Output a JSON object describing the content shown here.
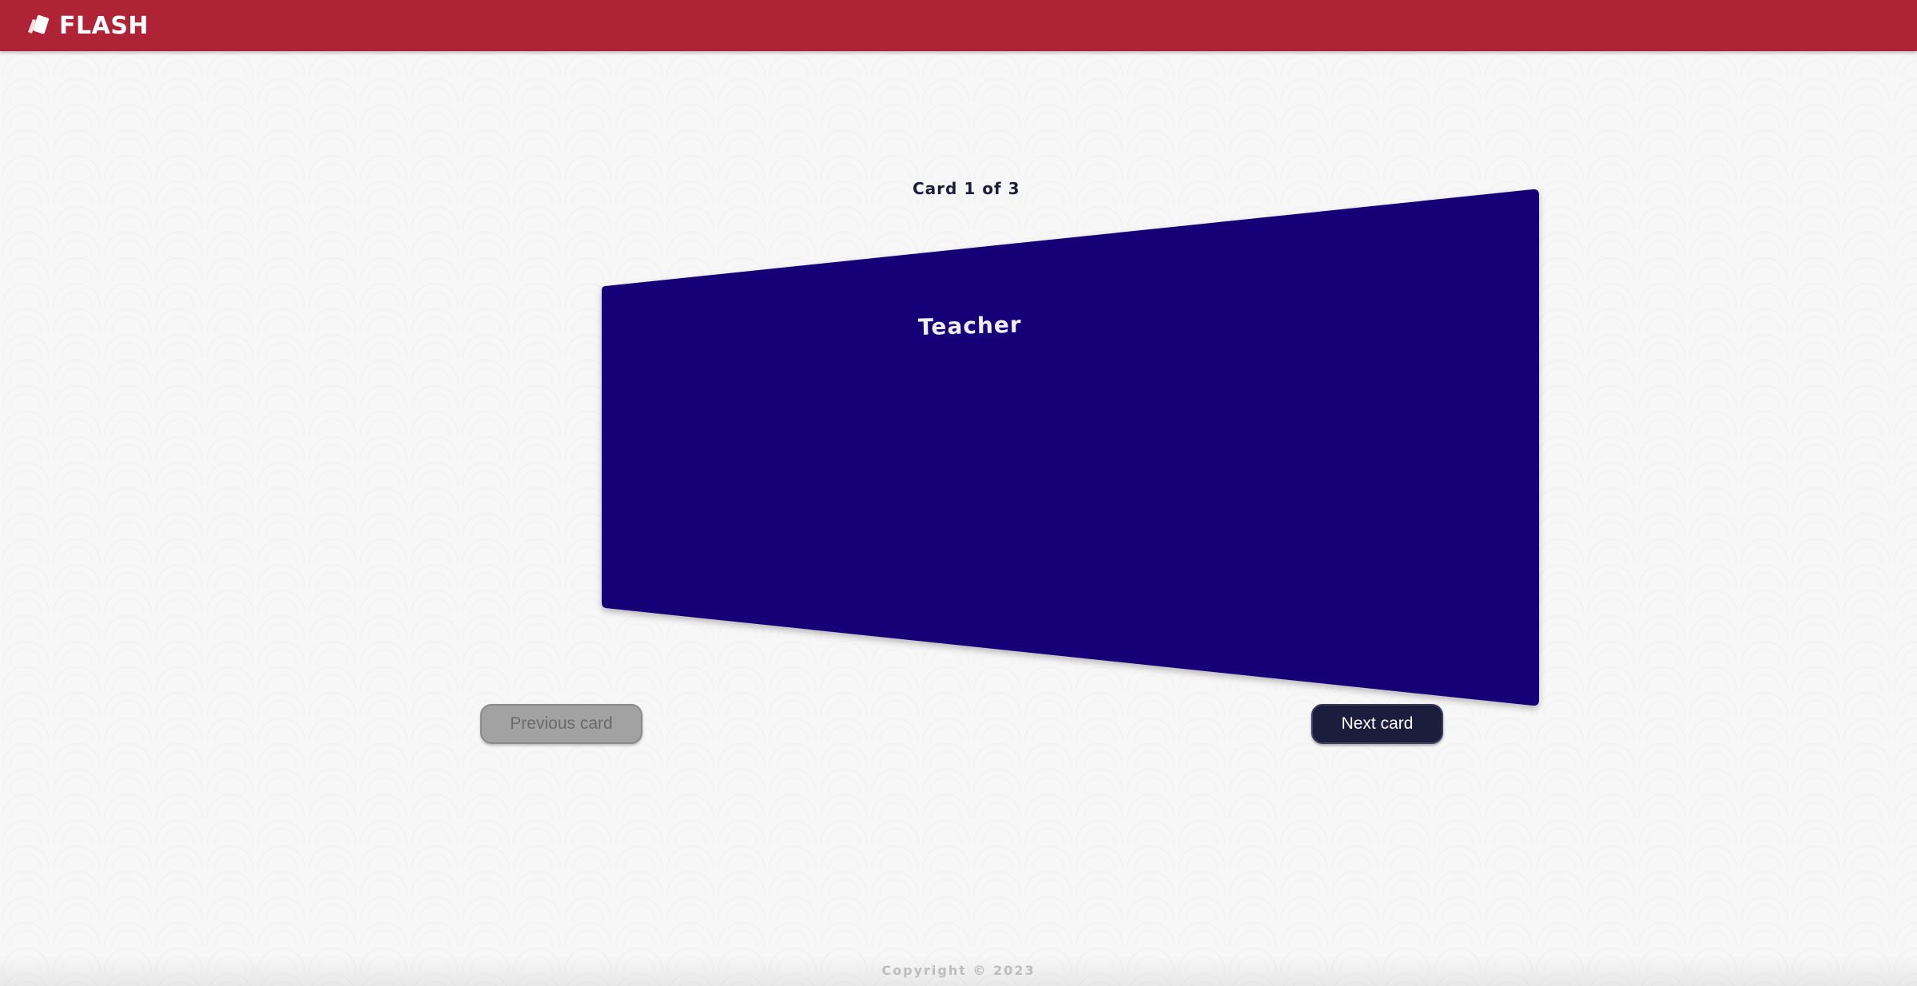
{
  "app": {
    "brand": "FLASH",
    "brand_icon": "cards-icon"
  },
  "deck": {
    "counter_text": "Card 1 of 3",
    "current_card_word": "Teacher",
    "card_color": "#140078"
  },
  "navigation": {
    "previous_label": "Previous card",
    "next_label": "Next card"
  },
  "footer": {
    "copyright": "Copyright © 2023"
  },
  "colors": {
    "header": "#ae2335",
    "next_button": "#1a1d3c",
    "previous_button_disabled": "#a2a2a2"
  }
}
